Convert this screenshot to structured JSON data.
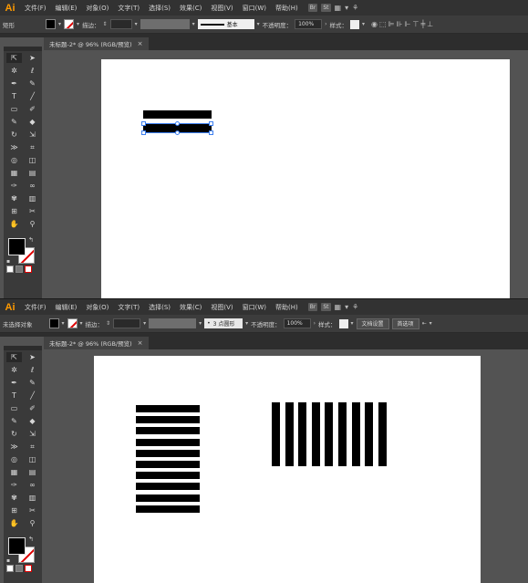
{
  "app": {
    "logo": "Ai"
  },
  "menus": [
    "文件(F)",
    "编辑(E)",
    "对象(O)",
    "文字(T)",
    "选择(S)",
    "效果(C)",
    "视图(V)",
    "窗口(W)",
    "帮助(H)"
  ],
  "menu_tools": {
    "bridge": "Br",
    "stock": "St"
  },
  "top": {
    "control": {
      "object_label": "矩形",
      "stroke_label": "描边：",
      "stroke_profile": "基本",
      "opacity_label": "不透明度：",
      "opacity_value": "100%",
      "style_label": "样式："
    },
    "tab": {
      "title": "未标题-2* @ 96% (RGB/预览)",
      "close": "×"
    }
  },
  "bottom": {
    "control": {
      "object_label": "未选择对象",
      "stroke_label": "描边：",
      "brush_value": "3 点圆形",
      "opacity_label": "不透明度：",
      "opacity_value": "100%",
      "style_label": "样式：",
      "doc_setup": "文档设置",
      "preferences": "首选项"
    },
    "tab": {
      "title": "未标题-2* @ 96% (RGB/预览)",
      "close": "×"
    }
  },
  "colors": {
    "accent": "#ff9a00",
    "selection": "#3d7ff0",
    "panel": "#535353",
    "bar": "#323232"
  }
}
